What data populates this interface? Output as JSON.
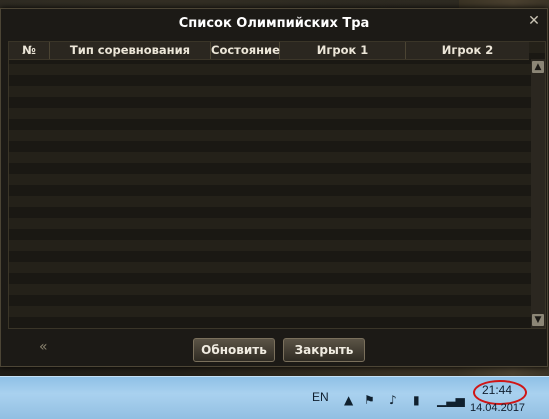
{
  "dialog": {
    "title": "Список Олимпийских Тра",
    "close_symbol": "✕",
    "columns": [
      "№",
      "Тип соревнования",
      "Состояние",
      "Игрок 1",
      "Игрок 2"
    ],
    "rows": [],
    "refresh_label": "Обновить",
    "close_label": "Закрыть"
  },
  "taskbar": {
    "language": "EN",
    "time": "21:44",
    "date": "14.04.2017"
  },
  "colors": {
    "highlight_circle": "#d01616",
    "taskbar": "#a9d1ef"
  }
}
